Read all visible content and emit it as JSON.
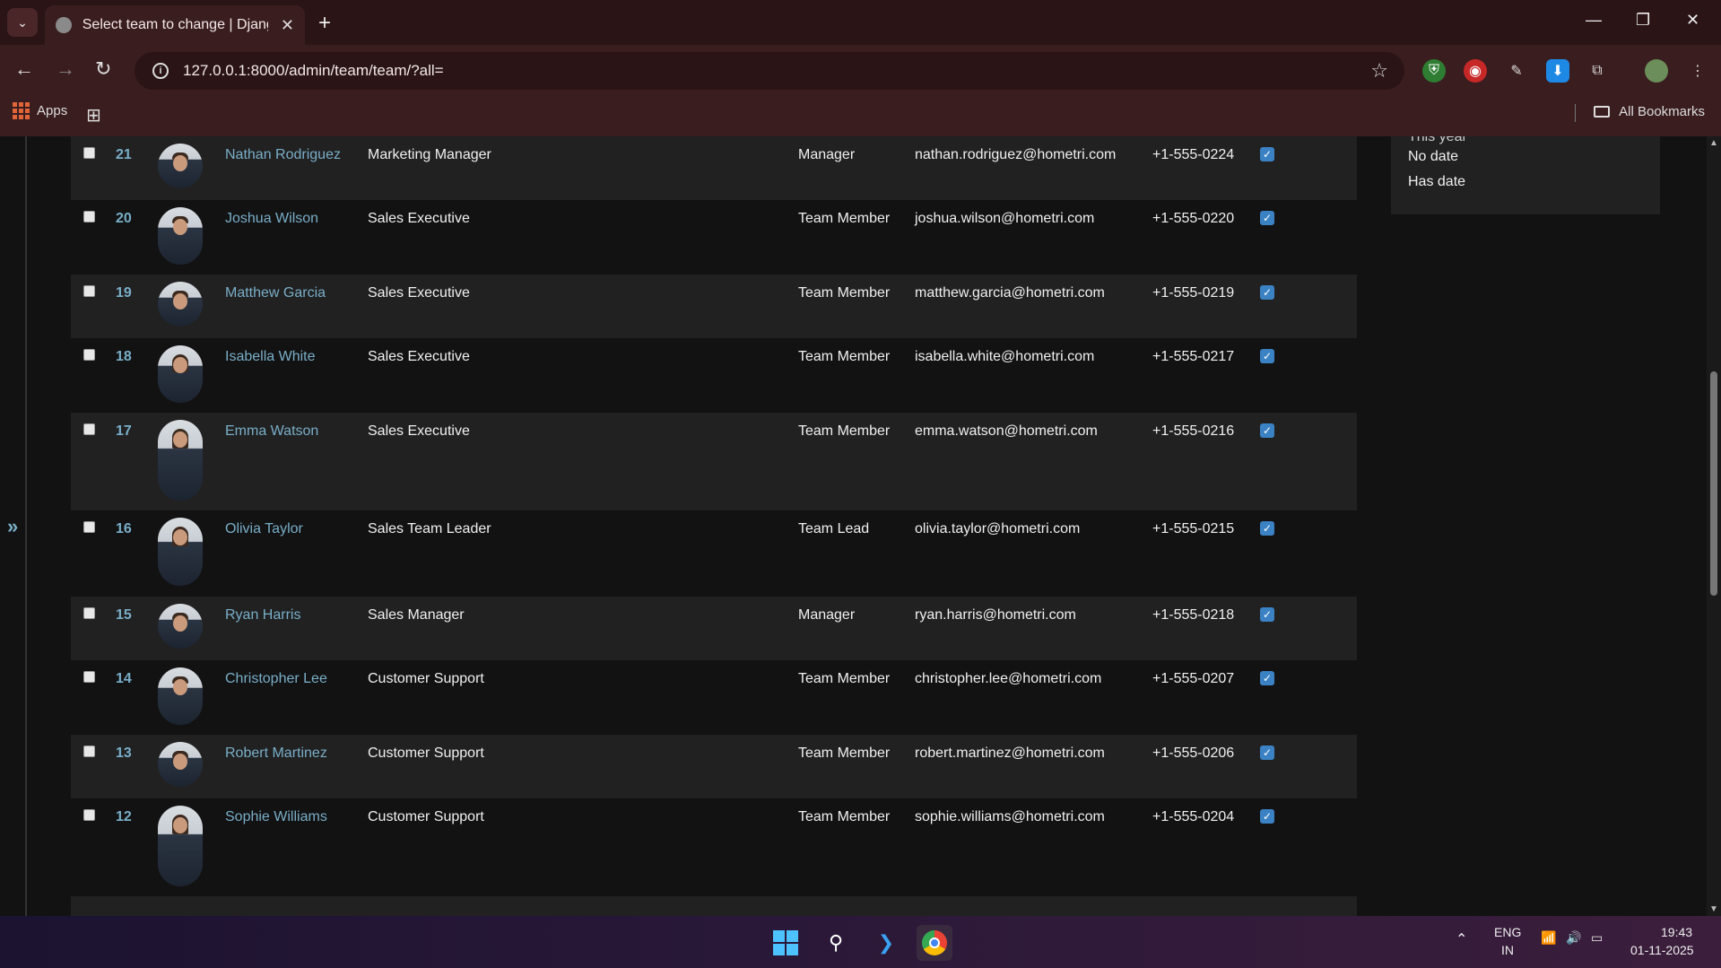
{
  "browser": {
    "tab_title": "Select team to change | Django",
    "url": "127.0.0.1:8000/admin/team/team/?all=",
    "bookmarks": {
      "apps_label": "Apps",
      "all_bookmarks_label": "All Bookmarks"
    }
  },
  "filter": {
    "items": [
      "This year",
      "No date",
      "Has date"
    ]
  },
  "rows": [
    {
      "id": "21",
      "name": "Nathan Rodriguez",
      "designation": "Marketing Manager",
      "role": "Manager",
      "email": "nathan.rodriguez@hometri.com",
      "phone": "+1-555-0224",
      "active": true
    },
    {
      "id": "20",
      "name": "Joshua Wilson",
      "designation": "Sales Executive",
      "role": "Team Member",
      "email": "joshua.wilson@hometri.com",
      "phone": "+1-555-0220",
      "active": true
    },
    {
      "id": "19",
      "name": "Matthew Garcia",
      "designation": "Sales Executive",
      "role": "Team Member",
      "email": "matthew.garcia@hometri.com",
      "phone": "+1-555-0219",
      "active": true
    },
    {
      "id": "18",
      "name": "Isabella White",
      "designation": "Sales Executive",
      "role": "Team Member",
      "email": "isabella.white@hometri.com",
      "phone": "+1-555-0217",
      "active": true
    },
    {
      "id": "17",
      "name": "Emma Watson",
      "designation": "Sales Executive",
      "role": "Team Member",
      "email": "emma.watson@hometri.com",
      "phone": "+1-555-0216",
      "active": true
    },
    {
      "id": "16",
      "name": "Olivia Taylor",
      "designation": "Sales Team Leader",
      "role": "Team Lead",
      "email": "olivia.taylor@hometri.com",
      "phone": "+1-555-0215",
      "active": true
    },
    {
      "id": "15",
      "name": "Ryan Harris",
      "designation": "Sales Manager",
      "role": "Manager",
      "email": "ryan.harris@hometri.com",
      "phone": "+1-555-0218",
      "active": true
    },
    {
      "id": "14",
      "name": "Christopher Lee",
      "designation": "Customer Support",
      "role": "Team Member",
      "email": "christopher.lee@hometri.com",
      "phone": "+1-555-0207",
      "active": true
    },
    {
      "id": "13",
      "name": "Robert Martinez",
      "designation": "Customer Support",
      "role": "Team Member",
      "email": "robert.martinez@hometri.com",
      "phone": "+1-555-0206",
      "active": true
    },
    {
      "id": "12",
      "name": "Sophie Williams",
      "designation": "Customer Support",
      "role": "Team Member",
      "email": "sophie.williams@hometri.com",
      "phone": "+1-555-0204",
      "active": true
    }
  ],
  "taskbar": {
    "lang_top": "ENG",
    "lang_bottom": "IN",
    "time": "19:43",
    "date": "01-11-2025"
  }
}
